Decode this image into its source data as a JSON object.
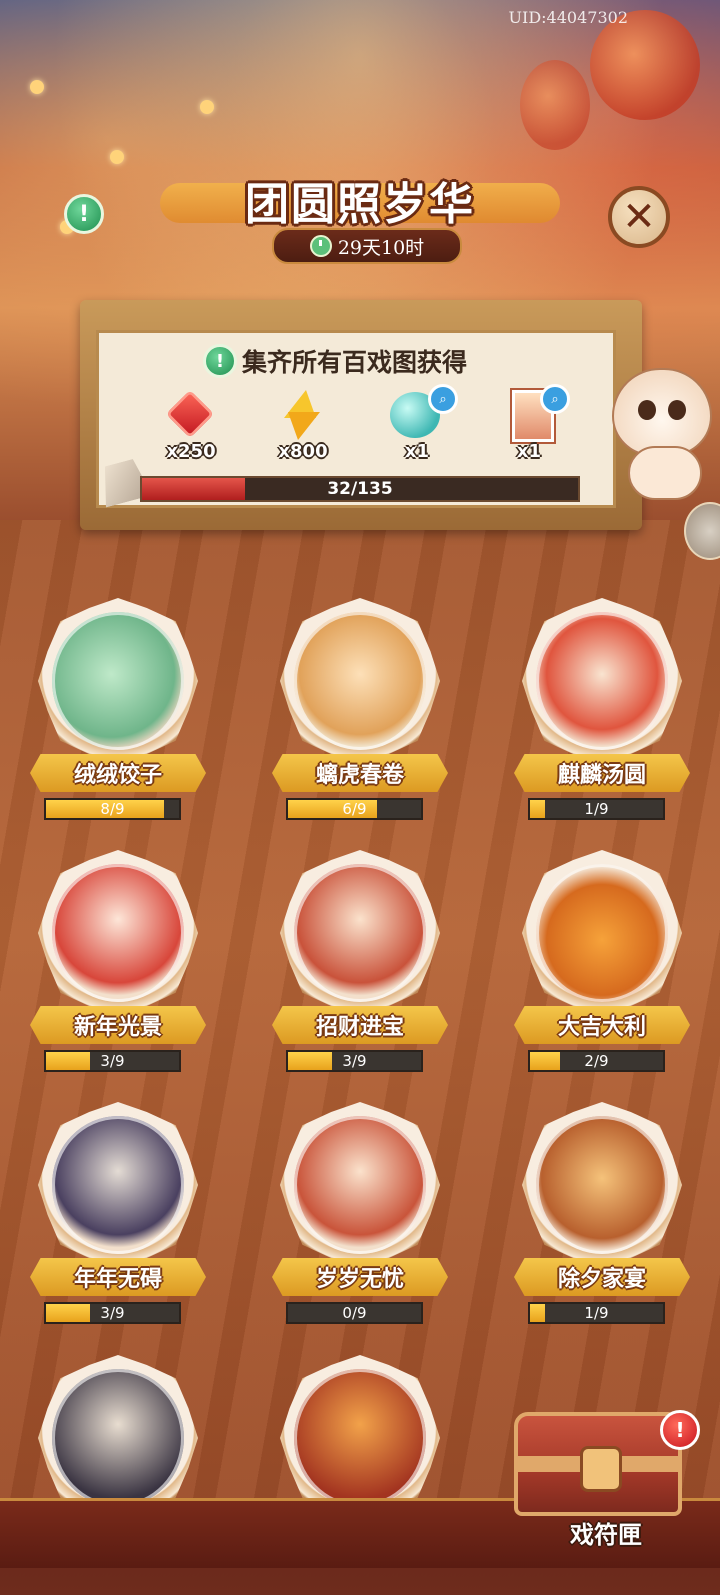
{
  "uid": "UID:44047302",
  "title": "团圆照岁华",
  "timer": "29天10时",
  "reward_board": {
    "title": "集齐所有百戏图获得",
    "rewards": [
      {
        "icon": "red-gem-icon",
        "count": "x250"
      },
      {
        "icon": "lightning-bolt-icon",
        "count": "x800"
      },
      {
        "icon": "jade-orb-icon",
        "count": "x1"
      },
      {
        "icon": "portrait-card-icon",
        "count": "x1"
      }
    ],
    "progress_text": "32/135",
    "progress_fraction": 0.237
  },
  "cards": [
    {
      "name": "绒绒饺子",
      "progress": "8/9",
      "fraction": 0.889
    },
    {
      "name": "螭虎春卷",
      "progress": "6/9",
      "fraction": 0.667
    },
    {
      "name": "麒麟汤圆",
      "progress": "1/9",
      "fraction": 0.111
    },
    {
      "name": "新年光景",
      "progress": "3/9",
      "fraction": 0.333
    },
    {
      "name": "招财进宝",
      "progress": "3/9",
      "fraction": 0.333
    },
    {
      "name": "大吉大利",
      "progress": "2/9",
      "fraction": 0.222
    },
    {
      "name": "年年无碍",
      "progress": "3/9",
      "fraction": 0.333
    },
    {
      "name": "岁岁无忧",
      "progress": "0/9",
      "fraction": 0.0
    },
    {
      "name": "除夕家宴",
      "progress": "1/9",
      "fraction": 0.111
    }
  ],
  "chest_label": "戏符匣",
  "colors": {
    "plate_gold": "#f4c64a",
    "progress_red": "#c43a22",
    "progress_yellow": "#ffd24a"
  }
}
